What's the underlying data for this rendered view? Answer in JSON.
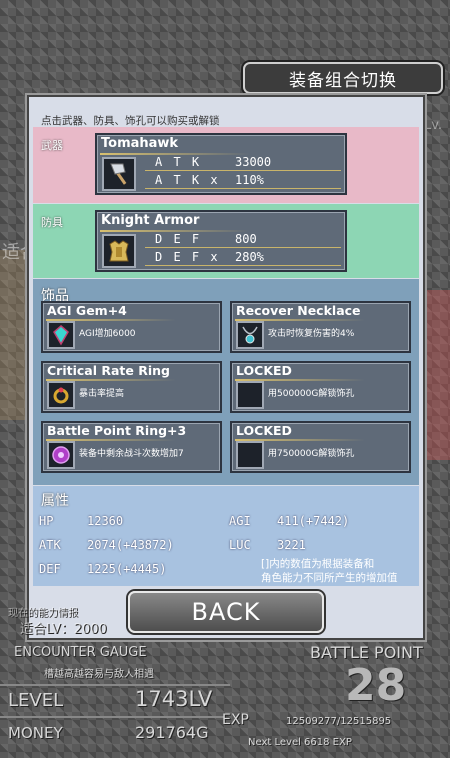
{
  "header": {
    "title": "装备组合切换"
  },
  "hint": "点击武器、防具、饰孔可以购买或解锁",
  "weapon": {
    "label": "武器",
    "name": "Tomahawk",
    "icon": "axe-icon",
    "stats": [
      {
        "label": "A T K",
        "value": "33000"
      },
      {
        "label": "A T K x",
        "value": "110%"
      }
    ]
  },
  "armor": {
    "label": "防具",
    "name": "Knight Armor",
    "icon": "armor-icon",
    "stats": [
      {
        "label": "D E F",
        "value": "800"
      },
      {
        "label": "D E F x",
        "value": "280%"
      }
    ]
  },
  "accessories": {
    "label": "饰品",
    "slots": [
      {
        "name": "AGI Gem+4",
        "desc": "AGI增加6000",
        "icon": "gem-icon"
      },
      {
        "name": "Recover Necklace",
        "desc": "攻击时恢复伤害的4%",
        "icon": "necklace-icon"
      },
      {
        "name": "Critical Rate Ring",
        "desc": "暴击率提高",
        "icon": "ring-icon"
      },
      {
        "name": "LOCKED",
        "desc": "用500000G解锁饰孔",
        "icon": "locked-slot-icon"
      },
      {
        "name": "Battle Point Ring+3",
        "desc": "装备中剩余战斗次数增加7",
        "icon": "orb-ring-icon"
      },
      {
        "name": "LOCKED",
        "desc": "用750000G解锁饰孔",
        "icon": "locked-slot-icon"
      }
    ]
  },
  "attributes": {
    "label": "属性",
    "hp": {
      "key": "HP",
      "value": "12360"
    },
    "atk": {
      "key": "ATK",
      "value": "2074(+43872)"
    },
    "def": {
      "key": "DEF",
      "value": "1225(+4445)"
    },
    "agi": {
      "key": "AGI",
      "value": "411(+7442)"
    },
    "luc": {
      "key": "LUC",
      "value": "3221"
    },
    "note1": "[]内的数值为根据装备和",
    "note2": "角色能力不同所产生的增加值"
  },
  "back_label": "BACK",
  "background": {
    "lv_text": "Lv.",
    "shiai": "适合L",
    "mid": "通合"
  },
  "hud": {
    "current_text": "现在的能力情报",
    "current_lv": "适合LV：2000",
    "gauge_title": "ENCOUNTER GAUGE",
    "gauge_desc": "槽越高越容易与敌人相遇",
    "battle_title": "BATTLE POINT",
    "battle_value": "28",
    "level_label": "LEVEL",
    "level_value": "1743LV",
    "money_label": "MONEY",
    "money_value": "291764G",
    "exp_label": "EXP",
    "exp_value": "12509277/12515895",
    "next_level": "Next Level 6618 EXP"
  }
}
